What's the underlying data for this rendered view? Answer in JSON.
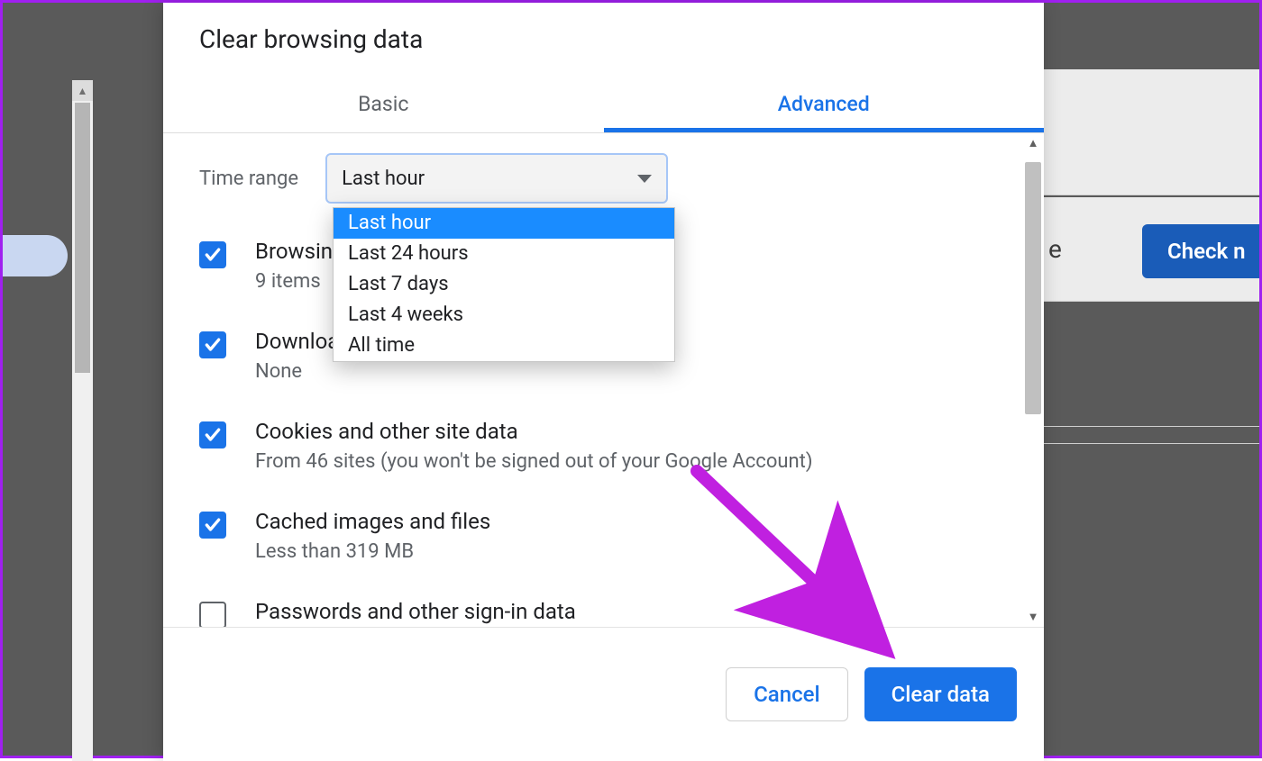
{
  "dialog": {
    "title": "Clear browsing data",
    "tabs": {
      "basic": "Basic",
      "advanced": "Advanced",
      "active": "advanced"
    },
    "timeRange": {
      "label": "Time range",
      "selected": "Last hour",
      "options": [
        "Last hour",
        "Last 24 hours",
        "Last 7 days",
        "Last 4 weeks",
        "All time"
      ]
    },
    "items": [
      {
        "title": "Browsing history",
        "title_truncated": "Browsin",
        "sub": "9 items",
        "checked": true
      },
      {
        "title": "Download history",
        "title_truncated": "Downloa",
        "sub": "None",
        "checked": true
      },
      {
        "title": "Cookies and other site data",
        "sub": "From 46 sites (you won't be signed out of your Google Account)",
        "checked": true
      },
      {
        "title": "Cached images and files",
        "sub": "Less than 319 MB",
        "checked": true
      },
      {
        "title": "Passwords and other sign-in data",
        "sub": "",
        "checked": false
      }
    ],
    "buttons": {
      "cancel": "Cancel",
      "confirm": "Clear data"
    }
  },
  "background": {
    "checkButton": "Check n"
  }
}
